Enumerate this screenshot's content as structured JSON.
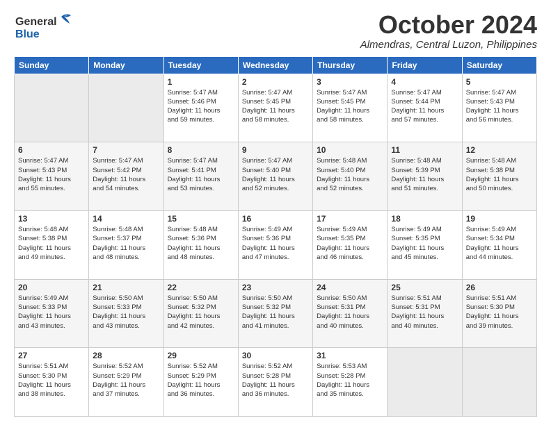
{
  "header": {
    "logo_line1": "General",
    "logo_line2": "Blue",
    "month": "October 2024",
    "location": "Almendras, Central Luzon, Philippines"
  },
  "weekdays": [
    "Sunday",
    "Monday",
    "Tuesday",
    "Wednesday",
    "Thursday",
    "Friday",
    "Saturday"
  ],
  "weeks": [
    [
      {
        "day": "",
        "info": ""
      },
      {
        "day": "",
        "info": ""
      },
      {
        "day": "1",
        "info": "Sunrise: 5:47 AM\nSunset: 5:46 PM\nDaylight: 11 hours\nand 59 minutes."
      },
      {
        "day": "2",
        "info": "Sunrise: 5:47 AM\nSunset: 5:45 PM\nDaylight: 11 hours\nand 58 minutes."
      },
      {
        "day": "3",
        "info": "Sunrise: 5:47 AM\nSunset: 5:45 PM\nDaylight: 11 hours\nand 58 minutes."
      },
      {
        "day": "4",
        "info": "Sunrise: 5:47 AM\nSunset: 5:44 PM\nDaylight: 11 hours\nand 57 minutes."
      },
      {
        "day": "5",
        "info": "Sunrise: 5:47 AM\nSunset: 5:43 PM\nDaylight: 11 hours\nand 56 minutes."
      }
    ],
    [
      {
        "day": "6",
        "info": "Sunrise: 5:47 AM\nSunset: 5:43 PM\nDaylight: 11 hours\nand 55 minutes."
      },
      {
        "day": "7",
        "info": "Sunrise: 5:47 AM\nSunset: 5:42 PM\nDaylight: 11 hours\nand 54 minutes."
      },
      {
        "day": "8",
        "info": "Sunrise: 5:47 AM\nSunset: 5:41 PM\nDaylight: 11 hours\nand 53 minutes."
      },
      {
        "day": "9",
        "info": "Sunrise: 5:47 AM\nSunset: 5:40 PM\nDaylight: 11 hours\nand 52 minutes."
      },
      {
        "day": "10",
        "info": "Sunrise: 5:48 AM\nSunset: 5:40 PM\nDaylight: 11 hours\nand 52 minutes."
      },
      {
        "day": "11",
        "info": "Sunrise: 5:48 AM\nSunset: 5:39 PM\nDaylight: 11 hours\nand 51 minutes."
      },
      {
        "day": "12",
        "info": "Sunrise: 5:48 AM\nSunset: 5:38 PM\nDaylight: 11 hours\nand 50 minutes."
      }
    ],
    [
      {
        "day": "13",
        "info": "Sunrise: 5:48 AM\nSunset: 5:38 PM\nDaylight: 11 hours\nand 49 minutes."
      },
      {
        "day": "14",
        "info": "Sunrise: 5:48 AM\nSunset: 5:37 PM\nDaylight: 11 hours\nand 48 minutes."
      },
      {
        "day": "15",
        "info": "Sunrise: 5:48 AM\nSunset: 5:36 PM\nDaylight: 11 hours\nand 48 minutes."
      },
      {
        "day": "16",
        "info": "Sunrise: 5:49 AM\nSunset: 5:36 PM\nDaylight: 11 hours\nand 47 minutes."
      },
      {
        "day": "17",
        "info": "Sunrise: 5:49 AM\nSunset: 5:35 PM\nDaylight: 11 hours\nand 46 minutes."
      },
      {
        "day": "18",
        "info": "Sunrise: 5:49 AM\nSunset: 5:35 PM\nDaylight: 11 hours\nand 45 minutes."
      },
      {
        "day": "19",
        "info": "Sunrise: 5:49 AM\nSunset: 5:34 PM\nDaylight: 11 hours\nand 44 minutes."
      }
    ],
    [
      {
        "day": "20",
        "info": "Sunrise: 5:49 AM\nSunset: 5:33 PM\nDaylight: 11 hours\nand 43 minutes."
      },
      {
        "day": "21",
        "info": "Sunrise: 5:50 AM\nSunset: 5:33 PM\nDaylight: 11 hours\nand 43 minutes."
      },
      {
        "day": "22",
        "info": "Sunrise: 5:50 AM\nSunset: 5:32 PM\nDaylight: 11 hours\nand 42 minutes."
      },
      {
        "day": "23",
        "info": "Sunrise: 5:50 AM\nSunset: 5:32 PM\nDaylight: 11 hours\nand 41 minutes."
      },
      {
        "day": "24",
        "info": "Sunrise: 5:50 AM\nSunset: 5:31 PM\nDaylight: 11 hours\nand 40 minutes."
      },
      {
        "day": "25",
        "info": "Sunrise: 5:51 AM\nSunset: 5:31 PM\nDaylight: 11 hours\nand 40 minutes."
      },
      {
        "day": "26",
        "info": "Sunrise: 5:51 AM\nSunset: 5:30 PM\nDaylight: 11 hours\nand 39 minutes."
      }
    ],
    [
      {
        "day": "27",
        "info": "Sunrise: 5:51 AM\nSunset: 5:30 PM\nDaylight: 11 hours\nand 38 minutes."
      },
      {
        "day": "28",
        "info": "Sunrise: 5:52 AM\nSunset: 5:29 PM\nDaylight: 11 hours\nand 37 minutes."
      },
      {
        "day": "29",
        "info": "Sunrise: 5:52 AM\nSunset: 5:29 PM\nDaylight: 11 hours\nand 36 minutes."
      },
      {
        "day": "30",
        "info": "Sunrise: 5:52 AM\nSunset: 5:28 PM\nDaylight: 11 hours\nand 36 minutes."
      },
      {
        "day": "31",
        "info": "Sunrise: 5:53 AM\nSunset: 5:28 PM\nDaylight: 11 hours\nand 35 minutes."
      },
      {
        "day": "",
        "info": ""
      },
      {
        "day": "",
        "info": ""
      }
    ]
  ]
}
